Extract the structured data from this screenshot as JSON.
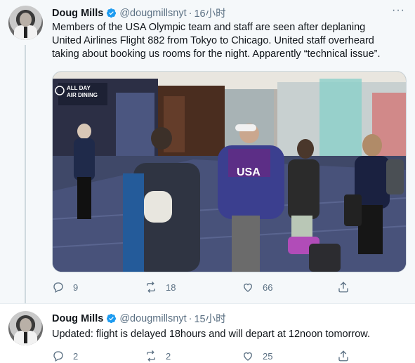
{
  "tweets": [
    {
      "name": "Doug Mills",
      "handle": "@dougmillsnyt",
      "dot": "·",
      "time": "16小时",
      "more": "···",
      "text_lines": [
        "Members of the USA Olympic team and staff are seen after deplaning",
        "United Airlines Flight 882 from Tokyo to Chicago. United staff overheard",
        "taking about booking us rooms for the night. Apparently “technical issue”."
      ],
      "photo": {
        "sign_text": "ALL DAY\nAIR DINING",
        "jacket_text": "USA"
      },
      "replies": "9",
      "retweets": "18",
      "likes": "66"
    },
    {
      "name": "Doug Mills",
      "handle": "@dougmillsnyt",
      "dot": "·",
      "time": "15小时",
      "text": "Updated: flight is delayed 18hours and will depart at 12noon tomorrow.",
      "replies": "2",
      "retweets": "2",
      "likes": "25"
    }
  ],
  "colors": {
    "accent": "#1d9bf0",
    "muted": "#5b7083",
    "background_highlight": "#f5f8fa"
  },
  "icons": [
    "verified-badge-icon",
    "more-icon",
    "reply-icon",
    "retweet-icon",
    "like-icon",
    "share-icon"
  ]
}
